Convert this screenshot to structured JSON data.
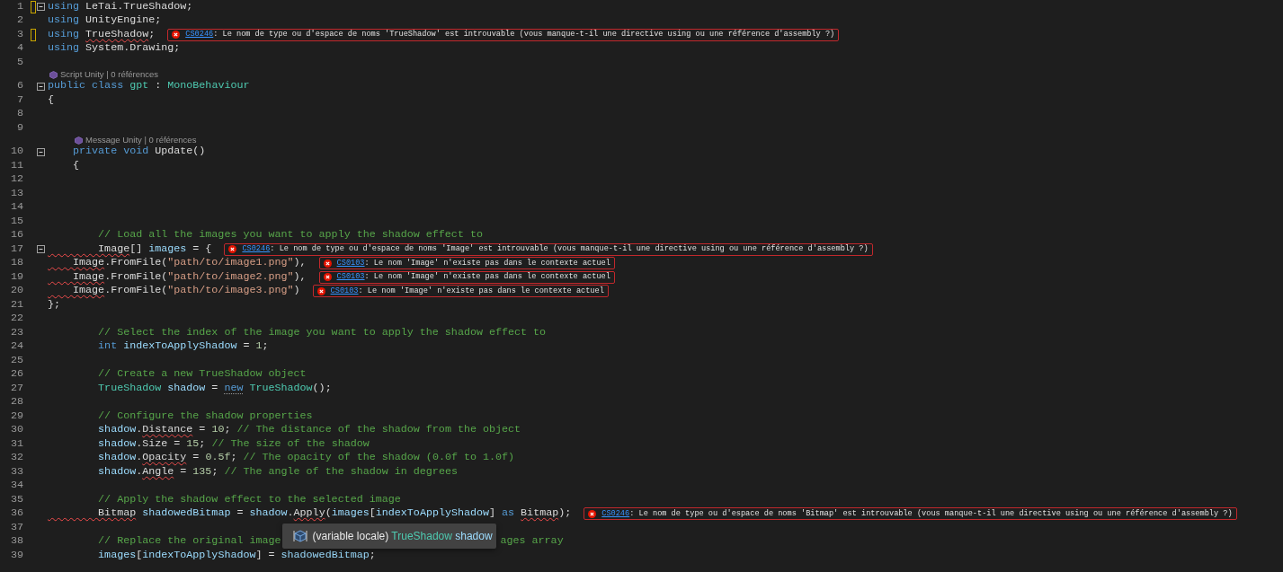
{
  "editor": {
    "lines": [
      {
        "kind": "code",
        "number": "1",
        "changed": true,
        "fold": true,
        "tokens": [
          {
            "kind": "keyword",
            "text": "using"
          },
          {
            "kind": "plain",
            "text": " LeTai.TrueShadow;"
          }
        ]
      },
      {
        "kind": "code",
        "number": "2",
        "changed": false,
        "fold": false,
        "tokens": [
          {
            "kind": "keyword",
            "text": "using"
          },
          {
            "kind": "plain",
            "text": " UnityEngine;"
          }
        ]
      },
      {
        "kind": "code",
        "number": "3",
        "changed": true,
        "fold": false,
        "tokens": [
          {
            "kind": "keyword",
            "text": "using "
          },
          {
            "kind": "error-plain",
            "text": "TrueShadow"
          },
          {
            "kind": "plain",
            "text": ";"
          }
        ],
        "error": {
          "code": "CS0246",
          "message": ": Le nom de type ou d'espace de noms 'TrueShadow' est introuvable (vous manque-t-il une directive using ou une référence d'assembly ?)"
        }
      },
      {
        "kind": "code",
        "number": "4",
        "changed": false,
        "fold": false,
        "tokens": [
          {
            "kind": "keyword",
            "text": "using"
          },
          {
            "kind": "plain",
            "text": " System.Drawing;"
          }
        ]
      },
      {
        "kind": "code",
        "number": "5",
        "changed": false,
        "fold": false
      },
      {
        "kind": "codelens",
        "text": "Script Unity | 0 références"
      },
      {
        "kind": "code",
        "number": "6",
        "changed": false,
        "fold": true,
        "tokens": [
          {
            "kind": "keyword",
            "text": "public class "
          },
          {
            "kind": "type",
            "text": "gpt"
          },
          {
            "kind": "plain",
            "text": " : "
          },
          {
            "kind": "type",
            "text": "MonoBehaviour"
          }
        ]
      },
      {
        "kind": "code",
        "number": "7",
        "changed": false,
        "fold": false,
        "tokens": [
          {
            "kind": "plain",
            "text": "{"
          }
        ]
      },
      {
        "kind": "code",
        "number": "8",
        "changed": false,
        "fold": false
      },
      {
        "kind": "code",
        "number": "9",
        "changed": false,
        "fold": false
      },
      {
        "kind": "codelens",
        "text": "    Message Unity | 0 références"
      },
      {
        "kind": "code",
        "number": "10",
        "changed": false,
        "fold": true,
        "tokens": [
          {
            "kind": "keyword",
            "text": "    private void"
          },
          {
            "kind": "plain",
            "text": " Update()"
          }
        ]
      },
      {
        "kind": "code",
        "number": "11",
        "changed": false,
        "fold": false,
        "tokens": [
          {
            "kind": "plain",
            "text": "    {"
          }
        ]
      },
      {
        "kind": "code",
        "number": "12",
        "changed": false,
        "fold": false
      },
      {
        "kind": "code",
        "number": "13",
        "changed": false,
        "fold": false
      },
      {
        "kind": "code",
        "number": "14",
        "changed": false,
        "fold": false
      },
      {
        "kind": "code",
        "number": "15",
        "changed": false,
        "fold": false
      },
      {
        "kind": "code",
        "number": "16",
        "changed": false,
        "fold": false,
        "tokens": [
          {
            "kind": "comment",
            "text": "        // Load all the images you want to apply the shadow effect to"
          }
        ]
      },
      {
        "kind": "code",
        "number": "17",
        "changed": false,
        "fold": true,
        "tokens": [
          {
            "kind": "error-type",
            "text": "        Image"
          },
          {
            "kind": "plain",
            "text": "[] "
          },
          {
            "kind": "variable",
            "text": "images"
          },
          {
            "kind": "plain",
            "text": " = {"
          }
        ],
        "error": {
          "code": "CS0246",
          "message": ": Le nom de type ou d'espace de noms 'Image' est introuvable (vous manque-t-il une directive using ou une référence d'assembly ?)"
        }
      },
      {
        "kind": "code",
        "number": "18",
        "changed": false,
        "fold": false,
        "tokens": [
          {
            "kind": "error-type",
            "text": "    Image"
          },
          {
            "kind": "plain",
            "text": ".FromFile("
          },
          {
            "kind": "string",
            "text": "\"path/to/image1.png\""
          },
          {
            "kind": "plain",
            "text": "),"
          }
        ],
        "error": {
          "code": "CS0103",
          "message": ": Le nom 'Image' n'existe pas dans le contexte actuel"
        }
      },
      {
        "kind": "code",
        "number": "19",
        "changed": false,
        "fold": false,
        "tokens": [
          {
            "kind": "error-type",
            "text": "    Image"
          },
          {
            "kind": "plain",
            "text": ".FromFile("
          },
          {
            "kind": "string",
            "text": "\"path/to/image2.png\""
          },
          {
            "kind": "plain",
            "text": "),"
          }
        ],
        "error": {
          "code": "CS0103",
          "message": ": Le nom 'Image' n'existe pas dans le contexte actuel"
        }
      },
      {
        "kind": "code",
        "number": "20",
        "changed": false,
        "fold": false,
        "tokens": [
          {
            "kind": "error-type",
            "text": "    Image"
          },
          {
            "kind": "plain",
            "text": ".FromFile("
          },
          {
            "kind": "string",
            "text": "\"path/to/image3.png\""
          },
          {
            "kind": "plain",
            "text": ")"
          }
        ],
        "error": {
          "code": "CS0103",
          "message": ": Le nom 'Image' n'existe pas dans le contexte actuel"
        }
      },
      {
        "kind": "code",
        "number": "21",
        "changed": false,
        "fold": false,
        "tokens": [
          {
            "kind": "plain",
            "text": "};"
          }
        ]
      },
      {
        "kind": "code",
        "number": "22",
        "changed": false,
        "fold": false
      },
      {
        "kind": "code",
        "number": "23",
        "changed": false,
        "fold": false,
        "tokens": [
          {
            "kind": "comment",
            "text": "        // Select the index of the image you want to apply the shadow effect to"
          }
        ]
      },
      {
        "kind": "code",
        "number": "24",
        "changed": false,
        "fold": false,
        "tokens": [
          {
            "kind": "keyword",
            "text": "        int "
          },
          {
            "kind": "variable",
            "text": "indexToApplyShadow"
          },
          {
            "kind": "plain",
            "text": " = "
          },
          {
            "kind": "number",
            "text": "1"
          },
          {
            "kind": "plain",
            "text": ";"
          }
        ]
      },
      {
        "kind": "code",
        "number": "25",
        "changed": false,
        "fold": false
      },
      {
        "kind": "code",
        "number": "26",
        "changed": false,
        "fold": false,
        "tokens": [
          {
            "kind": "comment",
            "text": "        // Create a new TrueShadow object"
          }
        ]
      },
      {
        "kind": "code",
        "number": "27",
        "changed": false,
        "fold": false,
        "tokens": [
          {
            "kind": "type",
            "text": "        TrueShadow "
          },
          {
            "kind": "variable",
            "text": "shadow"
          },
          {
            "kind": "plain",
            "text": " = "
          },
          {
            "kind": "hint-keyword",
            "text": "new"
          },
          {
            "kind": "type",
            "text": " TrueShadow"
          },
          {
            "kind": "plain",
            "text": "();"
          }
        ]
      },
      {
        "kind": "code",
        "number": "28",
        "changed": false,
        "fold": false
      },
      {
        "kind": "code",
        "number": "29",
        "changed": false,
        "fold": false,
        "tokens": [
          {
            "kind": "comment",
            "text": "        // Configure the shadow properties"
          }
        ]
      },
      {
        "kind": "code",
        "number": "30",
        "changed": false,
        "fold": false,
        "tokens": [
          {
            "kind": "variable",
            "text": "        shadow"
          },
          {
            "kind": "plain",
            "text": "."
          },
          {
            "kind": "error-plain",
            "text": "Distance"
          },
          {
            "kind": "plain",
            "text": " = "
          },
          {
            "kind": "number",
            "text": "10"
          },
          {
            "kind": "plain",
            "text": "; "
          },
          {
            "kind": "comment",
            "text": "// The distance of the shadow from the object"
          }
        ]
      },
      {
        "kind": "code",
        "number": "31",
        "changed": false,
        "fold": false,
        "tokens": [
          {
            "kind": "variable",
            "text": "        shadow"
          },
          {
            "kind": "plain",
            "text": ".Size = "
          },
          {
            "kind": "number",
            "text": "15"
          },
          {
            "kind": "plain",
            "text": "; "
          },
          {
            "kind": "comment",
            "text": "// The size of the shadow"
          }
        ]
      },
      {
        "kind": "code",
        "number": "32",
        "changed": false,
        "fold": false,
        "tokens": [
          {
            "kind": "variable",
            "text": "        shadow"
          },
          {
            "kind": "plain",
            "text": "."
          },
          {
            "kind": "error-plain",
            "text": "Opacity"
          },
          {
            "kind": "plain",
            "text": " = "
          },
          {
            "kind": "number",
            "text": "0.5f"
          },
          {
            "kind": "plain",
            "text": "; "
          },
          {
            "kind": "comment",
            "text": "// The opacity of the shadow (0.0f to 1.0f)"
          }
        ]
      },
      {
        "kind": "code",
        "number": "33",
        "changed": false,
        "fold": false,
        "tokens": [
          {
            "kind": "variable",
            "text": "        shadow"
          },
          {
            "kind": "plain",
            "text": "."
          },
          {
            "kind": "error-plain",
            "text": "Angle"
          },
          {
            "kind": "plain",
            "text": " = "
          },
          {
            "kind": "number",
            "text": "135"
          },
          {
            "kind": "plain",
            "text": "; "
          },
          {
            "kind": "comment",
            "text": "// The angle of the shadow in degrees"
          }
        ]
      },
      {
        "kind": "code",
        "number": "34",
        "changed": false,
        "fold": false
      },
      {
        "kind": "code",
        "number": "35",
        "changed": false,
        "fold": false,
        "tokens": [
          {
            "kind": "comment",
            "text": "        // Apply the shadow effect to the selected image"
          }
        ]
      },
      {
        "kind": "code",
        "number": "36",
        "changed": false,
        "fold": false,
        "tokens": [
          {
            "kind": "error-type",
            "text": "        Bitmap"
          },
          {
            "kind": "variable",
            "text": " shadowedBitmap"
          },
          {
            "kind": "plain",
            "text": " = "
          },
          {
            "kind": "variable",
            "text": "shadow"
          },
          {
            "kind": "plain",
            "text": "."
          },
          {
            "kind": "error-plain",
            "text": "Apply"
          },
          {
            "kind": "plain",
            "text": "("
          },
          {
            "kind": "variable",
            "text": "images"
          },
          {
            "kind": "plain",
            "text": "["
          },
          {
            "kind": "variable",
            "text": "indexToApplyShadow"
          },
          {
            "kind": "plain",
            "text": "] "
          },
          {
            "kind": "keyword",
            "text": "as "
          },
          {
            "kind": "error-type",
            "text": "Bitmap"
          },
          {
            "kind": "plain",
            "text": ");"
          }
        ],
        "error": {
          "code": "CS0246",
          "message": ": Le nom de type ou d'espace de noms 'Bitmap' est introuvable (vous manque-t-il une directive using ou une référence d'assembly ?)"
        }
      },
      {
        "kind": "code",
        "number": "37",
        "changed": false,
        "fold": false
      },
      {
        "kind": "code",
        "number": "38",
        "changed": false,
        "fold": false,
        "tokens": [
          {
            "kind": "comment",
            "text": "        // Replace the original image"
          },
          {
            "kind": "comment",
            "text": "ages array"
          }
        ],
        "tooltip": {
          "parts": [
            {
              "kind": "plain",
              "text": "(variable locale) "
            },
            {
              "kind": "type",
              "text": "TrueShadow"
            },
            {
              "kind": "variable",
              "text": " shadow"
            }
          ]
        }
      },
      {
        "kind": "code",
        "number": "39",
        "changed": false,
        "fold": false,
        "tokens": [
          {
            "kind": "variable",
            "text": "        images"
          },
          {
            "kind": "plain",
            "text": "["
          },
          {
            "kind": "variable",
            "text": "indexToApplyShadow"
          },
          {
            "kind": "plain",
            "text": "] = "
          },
          {
            "kind": "variable",
            "text": "shadowedBitmap"
          },
          {
            "kind": "plain",
            "text": ";"
          }
        ]
      }
    ]
  }
}
